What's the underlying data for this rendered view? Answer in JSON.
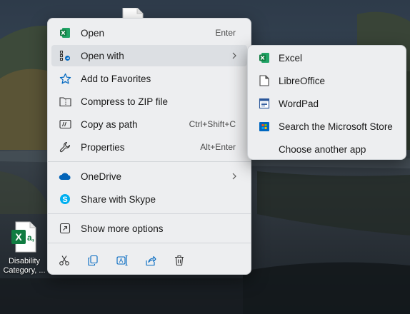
{
  "desktop": {
    "file_icon_caption_line1": "Disability",
    "file_icon_caption_line2": "Category, ...",
    "file_icon_glyph": "X",
    "file_icon_glyph_suffix": "a,"
  },
  "context_menu": {
    "items": [
      {
        "label": "Open",
        "shortcut": "Enter",
        "icon": "excel-icon"
      },
      {
        "label": "Open with",
        "icon": "open-with-icon",
        "has_submenu": true
      },
      {
        "label": "Add to Favorites",
        "icon": "star-icon"
      },
      {
        "label": "Compress to ZIP file",
        "icon": "zip-folder-icon"
      },
      {
        "label": "Copy as path",
        "shortcut": "Ctrl+Shift+C",
        "icon": "copy-path-icon"
      },
      {
        "label": "Properties",
        "shortcut": "Alt+Enter",
        "icon": "wrench-icon"
      },
      {
        "label": "OneDrive",
        "icon": "onedrive-cloud-icon",
        "has_submenu": true
      },
      {
        "label": "Share with Skype",
        "icon": "skype-icon"
      },
      {
        "label": "Show more options",
        "icon": "more-options-icon"
      }
    ],
    "action_bar": [
      "cut-icon",
      "copy-icon",
      "rename-icon",
      "share-icon",
      "delete-icon"
    ]
  },
  "open_with_submenu": {
    "items": [
      {
        "label": "Excel",
        "icon": "excel-icon"
      },
      {
        "label": "LibreOffice",
        "icon": "libreoffice-icon"
      },
      {
        "label": "WordPad",
        "icon": "wordpad-icon"
      },
      {
        "label": "Search the Microsoft Store",
        "icon": "microsoft-store-icon"
      },
      {
        "label": "Choose another app"
      }
    ]
  },
  "colors": {
    "excel_green": "#107c41",
    "accent_blue": "#0067c0",
    "menu_background": "#edeef0",
    "skype_blue": "#00aff0"
  }
}
